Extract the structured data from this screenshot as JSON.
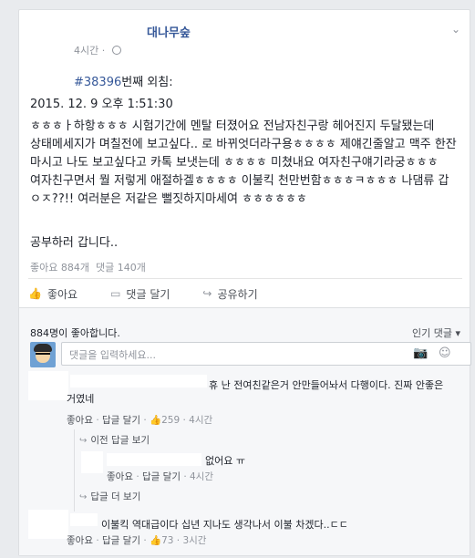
{
  "post": {
    "page_name": "대나무숲",
    "time": "4시간",
    "hashtag": "#38396",
    "hashtag_suffix": "번째 외침:",
    "datetime": "2015. 12. 9 오후 1:51:30",
    "body": "ㅎㅎㅎㅏ하항ㅎㅎㅎ 시험기간에 멘탈 터졌어요 전남자친구랑 헤어진지 두달됐는데 상태메세지가 며칠전에 보고싶다.. 로 바뀌엇더라구용ㅎㅎㅎㅎ 제얘긴줄알고 맥주 한잔 마시고 나도 보고싶다고 카톡 보냇는데 ㅎㅎㅎㅎ 미쳤내요 여자친구얘기라궁ㅎㅎㅎ 여자친구면서 뭘 저렇게 애절하겔ㅎㅎㅎㅎ 이불킥 천만번함ㅎㅎㅎㅋㅎㅎㅎ 나댐류 갑 ㅇㅈ??!! 여러분은 저같은 뻘짓하지마세여 ㅎㅎㅎㅎㅎㅎ",
    "outro": "공부하러 갑니다..",
    "likes_stat": "좋아요 884개",
    "comments_stat": "댓글 140개"
  },
  "actions": {
    "like": "좋아요",
    "comment": "댓글 달기",
    "share": "공유하기"
  },
  "comments_header": {
    "likes_text": "884명이 좋아합니다.",
    "sort": "인기 댓글"
  },
  "comment_input": {
    "placeholder": "댓글을 입력하세요..."
  },
  "comments": [
    {
      "prefix": "",
      "text": "휴 난 전여친같은거 안만들어놔서 다행이다. 진짜 안좋은거였네",
      "like_label": "좋아요",
      "reply_label": "답글 달기",
      "like_count": "259",
      "time": "4시간"
    },
    {
      "text": "이불킥 역대급이다 십년 지나도 생각나서 이불 차겠다..ㄷㄷ",
      "like_label": "좋아요",
      "reply_label": "답글 달기",
      "like_count": "73",
      "time": "3시간"
    }
  ],
  "prev_replies": "이전 답글 보기",
  "reply": {
    "text": "없어요 ㅠ",
    "like_label": "좋아요",
    "reply_label": "답글 달기",
    "time": "4시간"
  },
  "more_replies": "답글 더 보기"
}
